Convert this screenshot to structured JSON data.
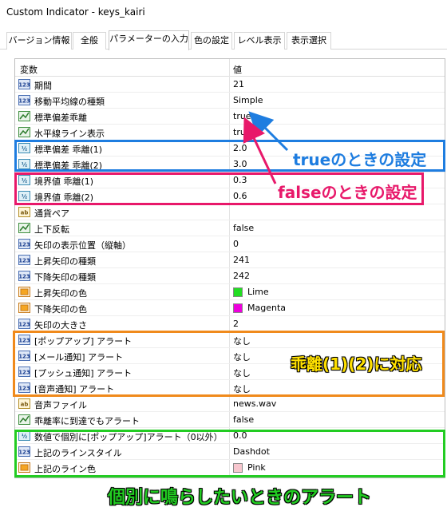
{
  "window": {
    "title": "Custom Indicator - keys_kairi"
  },
  "tabs": [
    {
      "label": "バージョン情報",
      "active": false
    },
    {
      "label": "全般",
      "active": false
    },
    {
      "label": "パラメーターの入力",
      "active": true
    },
    {
      "label": "色の設定",
      "active": false
    },
    {
      "label": "レベル表示",
      "active": false
    },
    {
      "label": "表示選択",
      "active": false
    }
  ],
  "grid": {
    "headers": {
      "variable": "変数",
      "value": "値"
    },
    "rows": [
      {
        "icon": "int-icon",
        "name": "期間",
        "value": "21"
      },
      {
        "icon": "int-icon",
        "name": "移動平均線の種類",
        "value": "Simple"
      },
      {
        "icon": "bool-icon",
        "name": "標準偏差乖離",
        "value": "true"
      },
      {
        "icon": "bool-icon",
        "name": "水平線ライン表示",
        "value": "true"
      },
      {
        "icon": "double-icon",
        "name": "標準偏差 乖離(1)",
        "value": "2.0"
      },
      {
        "icon": "double-icon",
        "name": "標準偏差 乖離(2)",
        "value": "3.0"
      },
      {
        "icon": "double-icon",
        "name": "境界値 乖離(1)",
        "value": "0.3"
      },
      {
        "icon": "double-icon",
        "name": "境界値 乖離(2)",
        "value": "0.6"
      },
      {
        "icon": "string-icon",
        "name": "通貨ペア",
        "value": ""
      },
      {
        "icon": "bool-icon",
        "name": "上下反転",
        "value": "false"
      },
      {
        "icon": "int-icon",
        "name": "矢印の表示位置（縦軸）",
        "value": "0"
      },
      {
        "icon": "int-icon",
        "name": "上昇矢印の種類",
        "value": "241"
      },
      {
        "icon": "int-icon",
        "name": "下降矢印の種類",
        "value": "242"
      },
      {
        "icon": "color-icon",
        "name": "上昇矢印の色",
        "value": "Lime",
        "swatch": "#22dd22"
      },
      {
        "icon": "color-icon",
        "name": "下降矢印の色",
        "value": "Magenta",
        "swatch": "#ee00dd"
      },
      {
        "icon": "int-icon",
        "name": "矢印の大きさ",
        "value": "2"
      },
      {
        "icon": "int-icon",
        "name": "[ポップアップ] アラート",
        "value": "なし"
      },
      {
        "icon": "int-icon",
        "name": "[メール通知] アラート",
        "value": "なし"
      },
      {
        "icon": "int-icon",
        "name": "[プッシュ通知] アラート",
        "value": "なし"
      },
      {
        "icon": "int-icon",
        "name": "[音声通知] アラート",
        "value": "なし"
      },
      {
        "icon": "string-icon",
        "name": "音声ファイル",
        "value": "news.wav"
      },
      {
        "icon": "bool-icon",
        "name": "乖離率に到達でもアラート",
        "value": "false"
      },
      {
        "icon": "double-icon",
        "name": "数値で個別に[ポップアップ]アラート（0以外）",
        "value": "0.0"
      },
      {
        "icon": "int-icon",
        "name": "上記のラインスタイル",
        "value": "Dashdot"
      },
      {
        "icon": "color-icon",
        "name": "上記のライン色",
        "value": "Pink",
        "swatch": "#f7c6ce"
      }
    ]
  },
  "annotations": {
    "true_label": "trueのときの設定",
    "false_label": "falseのときの設定",
    "alert_label": "乖離(1)(2)に対応",
    "individual_label": "個別に鳴らしたいときのアラート",
    "colors": {
      "blue": "#1e7de0",
      "pink": "#e8186a",
      "orange": "#f08a1c",
      "green": "#22cc22",
      "yellow": "#ffe000"
    }
  }
}
